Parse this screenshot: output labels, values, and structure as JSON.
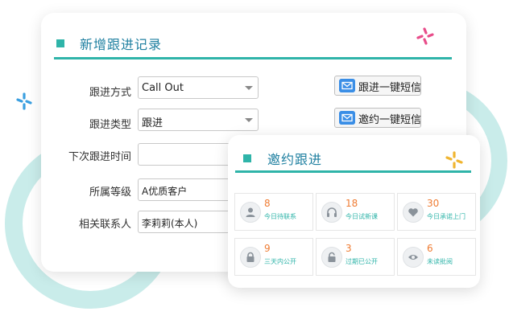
{
  "main_form": {
    "title": "新增跟进记录",
    "fields": [
      {
        "label": "跟进方式",
        "value": "Call Out"
      },
      {
        "label": "跟进类型",
        "value": "跟进"
      },
      {
        "label": "下次跟进时间",
        "value": ""
      },
      {
        "label": "所属等级",
        "value": "A优质客户"
      },
      {
        "label": "相关联系人",
        "value": "李莉莉(本人)"
      }
    ],
    "sms_buttons": [
      "跟进一键短信",
      "邀约一键短信"
    ]
  },
  "invite_card": {
    "title": "邀约跟进",
    "tiles": [
      {
        "count": "8",
        "label": "今日待联系",
        "icon": "person-icon"
      },
      {
        "count": "18",
        "label": "今日试新课",
        "icon": "headphones-icon"
      },
      {
        "count": "30",
        "label": "今日承诺上门",
        "icon": "heart-icon"
      },
      {
        "count": "9",
        "label": "三天内公开",
        "icon": "lock-icon"
      },
      {
        "count": "3",
        "label": "过期已公开",
        "icon": "unlock-icon"
      },
      {
        "count": "6",
        "label": "未读批阅",
        "icon": "eye-icon"
      }
    ]
  },
  "colors": {
    "accent": "#2fb4a9",
    "title": "#1e7fa0",
    "count": "#ef7c33",
    "ring": "#c9ecea",
    "mail_icon": "#3a8ee6"
  }
}
